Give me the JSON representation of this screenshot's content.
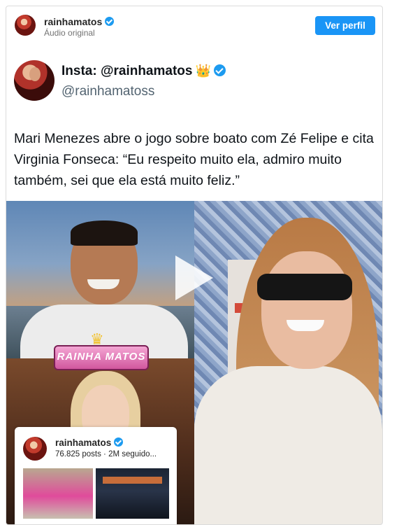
{
  "header": {
    "username": "rainhamatos",
    "audio_label": "Áudio original",
    "view_profile_label": "Ver perfil"
  },
  "tweet": {
    "display_name": "Insta: @rainhamatos",
    "crown_emoji": "👑",
    "handle": "@rainhamatoss",
    "text": "Mari Menezes abre o jogo sobre boato com Zé Felipe e cita Virginia Fonseca: “Eu respeito muito ela, admiro muito também, sei que ela está muito feliz.”"
  },
  "media": {
    "logo_text": "RAINHA MATOS",
    "logo_crown": "♛"
  },
  "profile_card": {
    "username": "rainhamatos",
    "stats": "76.825 posts · 2M seguido..."
  },
  "colors": {
    "accent": "#1a95f6",
    "verified": "#1d9bf0",
    "text_primary": "#0f1419",
    "text_secondary": "#536471"
  },
  "icons": [
    "verified-badge-icon",
    "crown-icon",
    "play-icon"
  ]
}
